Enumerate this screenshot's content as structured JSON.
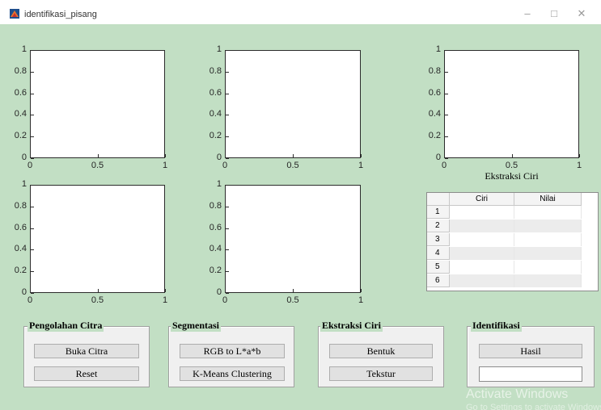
{
  "window": {
    "title": "identifikasi_pisang",
    "buttons": {
      "minimize": "–",
      "maximize": "□",
      "close": "✕"
    }
  },
  "colors": {
    "figure_bg": "#c2dfc4",
    "axes_bg": "#ffffff",
    "button_bg": "#e1e1e1"
  },
  "axes": [
    {
      "xlim": [
        0,
        1
      ],
      "ylim": [
        0,
        1
      ],
      "xticks": [
        "0",
        "0.5",
        "1"
      ],
      "yticks": [
        "0",
        "0.2",
        "0.4",
        "0.6",
        "0.8",
        "1"
      ],
      "xlabel": ""
    },
    {
      "xlim": [
        0,
        1
      ],
      "ylim": [
        0,
        1
      ],
      "xticks": [
        "0",
        "0.5",
        "1"
      ],
      "yticks": [
        "0",
        "0.2",
        "0.4",
        "0.6",
        "0.8",
        "1"
      ],
      "xlabel": ""
    },
    {
      "xlim": [
        0,
        1
      ],
      "ylim": [
        0,
        1
      ],
      "xticks": [
        "0",
        "0.5",
        "1"
      ],
      "yticks": [
        "0",
        "0.2",
        "0.4",
        "0.6",
        "0.8",
        "1"
      ],
      "xlabel": "Ekstraksi Ciri"
    },
    {
      "xlim": [
        0,
        1
      ],
      "ylim": [
        0,
        1
      ],
      "xticks": [
        "0",
        "0.5",
        "1"
      ],
      "yticks": [
        "0",
        "0.2",
        "0.4",
        "0.6",
        "0.8",
        "1"
      ],
      "xlabel": ""
    },
    {
      "xlim": [
        0,
        1
      ],
      "ylim": [
        0,
        1
      ],
      "xticks": [
        "0",
        "0.5",
        "1"
      ],
      "yticks": [
        "0",
        "0.2",
        "0.4",
        "0.6",
        "0.8",
        "1"
      ],
      "xlabel": ""
    }
  ],
  "table": {
    "columns": [
      "Ciri",
      "Nilai"
    ],
    "rows": [
      "1",
      "2",
      "3",
      "4",
      "5",
      "6"
    ]
  },
  "panels": {
    "pengolahan": {
      "title": "Pengolahan Citra",
      "buttons": [
        "Buka Citra",
        "Reset"
      ]
    },
    "segmentasi": {
      "title": "Segmentasi",
      "buttons": [
        "RGB to L*a*b",
        "K-Means Clustering"
      ]
    },
    "ekstraksi": {
      "title": "Ekstraksi Ciri",
      "buttons": [
        "Bentuk",
        "Tekstur"
      ]
    },
    "identifikasi": {
      "title": "Identifikasi",
      "buttons": [
        "Hasil"
      ],
      "result_value": ""
    }
  },
  "watermark": {
    "line1": "Activate Windows",
    "line2": "Go to Settings to activate Windows."
  }
}
